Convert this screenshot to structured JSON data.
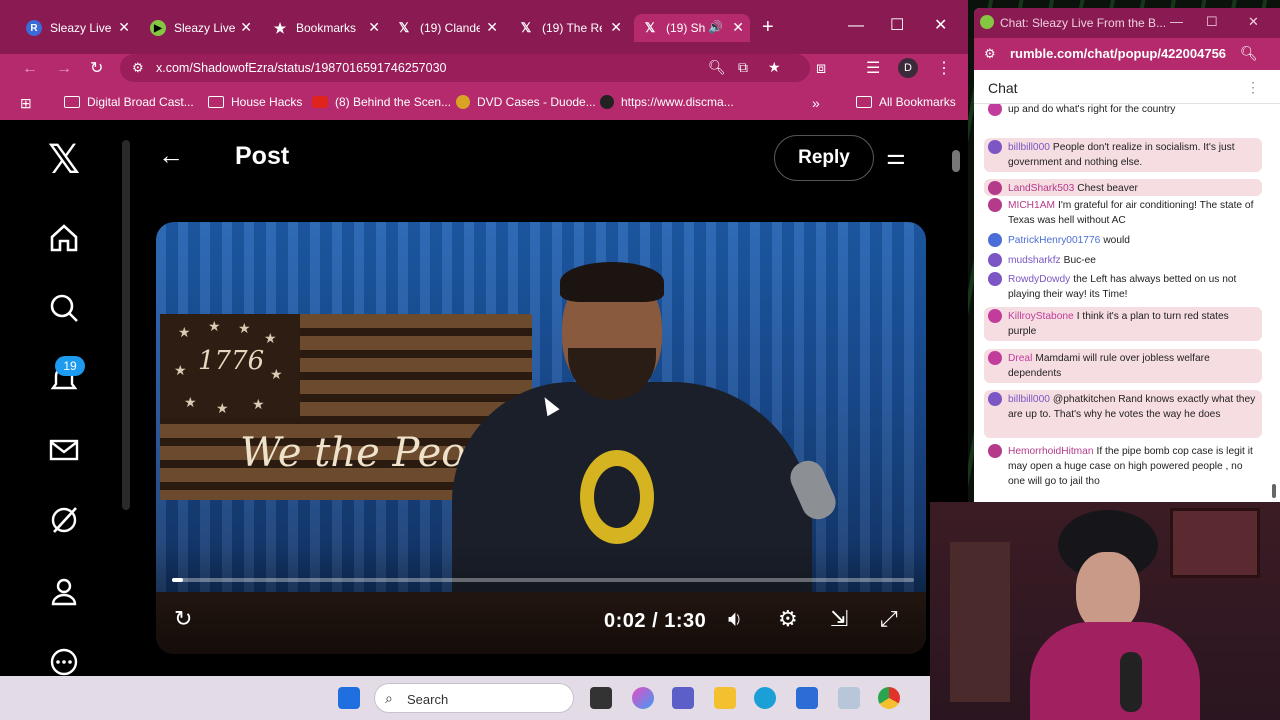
{
  "browser": {
    "tabs": [
      {
        "label": "Sleazy Live",
        "icon": "rumble-r-icon",
        "icon_color": "#3b6bd6"
      },
      {
        "label": "Sleazy Live",
        "icon": "rumble-play-icon",
        "icon_color": "#85c742"
      },
      {
        "label": "Bookmarks",
        "icon": "star-icon",
        "icon_color": "#ffffff"
      },
      {
        "label": "(19) Clande",
        "icon": "x-logo-icon",
        "icon_color": "#ffffff"
      },
      {
        "label": "(19) The Re",
        "icon": "x-logo-icon",
        "icon_color": "#ffffff"
      },
      {
        "label": "(19) Sh",
        "icon": "x-logo-icon",
        "icon_color": "#ffffff",
        "active": true
      }
    ],
    "url": "x.com/ShadowofEzra/status/1987016591746257030",
    "profile_initial": "D",
    "bookmarks": [
      {
        "label": "Digital Broad Cast...",
        "icon": "folder-icon"
      },
      {
        "label": "House Hacks",
        "icon": "folder-icon"
      },
      {
        "label": "(8) Behind the Scen...",
        "icon": "youtube-icon"
      },
      {
        "label": "DVD Cases - Duode...",
        "icon": "dvd-icon"
      },
      {
        "label": "https://www.discma...",
        "icon": "discmaker-icon"
      }
    ],
    "all_bookmarks": "All Bookmarks",
    "theme_color": "#b42a6c"
  },
  "x": {
    "page_title": "Post",
    "reply_label": "Reply",
    "notification_count": "19",
    "video": {
      "flag_year": "1776",
      "flag_text": "We the People",
      "time": "0:02 / 1:30",
      "progress": 0.015
    }
  },
  "taskbar": {
    "search_placeholder": "Search"
  },
  "chat": {
    "window_title": "Chat: Sleazy Live From the B...",
    "url": "rumble.com/chat/popup/422004756",
    "header": "Chat",
    "messages": [
      {
        "user": "",
        "text": "up and do what's right for the country",
        "color": "#c23d9b",
        "highlight": false
      },
      {
        "user": "billbill000",
        "text": "People don't realize in socialism. It's just government and nothing else.",
        "color": "#7b56c4",
        "highlight": true
      },
      {
        "user": "LandShark503",
        "text": "Chest beaver",
        "color": "#b43a8a",
        "highlight": true
      },
      {
        "user": "MICH1AM",
        "text": "I'm grateful for air conditioning! The state of Texas was hell without AC",
        "color": "#b43a8a",
        "highlight": false
      },
      {
        "user": "PatrickHenry001776",
        "text": "would",
        "color": "#4b6ed6",
        "highlight": false
      },
      {
        "user": "mudsharkfz",
        "text": "Buc-ee",
        "color": "#7b56c4",
        "highlight": false
      },
      {
        "user": "RowdyDowdy",
        "text": "the Left has always betted on us not playing their way! its Time!",
        "color": "#7b56c4",
        "highlight": false
      },
      {
        "user": "KillroyStabone",
        "text": "I think it's a plan to turn red states purple",
        "color": "#c23d9b",
        "highlight": true
      },
      {
        "user": "Dreal",
        "text": "Mamdami will rule over jobless welfare dependents",
        "color": "#c23d9b",
        "highlight": true
      },
      {
        "user": "billbill000",
        "text": "@phatkitchen Rand knows exactly what they are up to. That's why he votes the way he does",
        "color": "#7b56c4",
        "highlight": true
      },
      {
        "user": "HemorrhoidHitman",
        "text": "If the pipe bomb cop case is legit it may open a huge case on high powered people , no one will go to jail tho",
        "color": "#b43a8a",
        "highlight": false
      }
    ]
  }
}
